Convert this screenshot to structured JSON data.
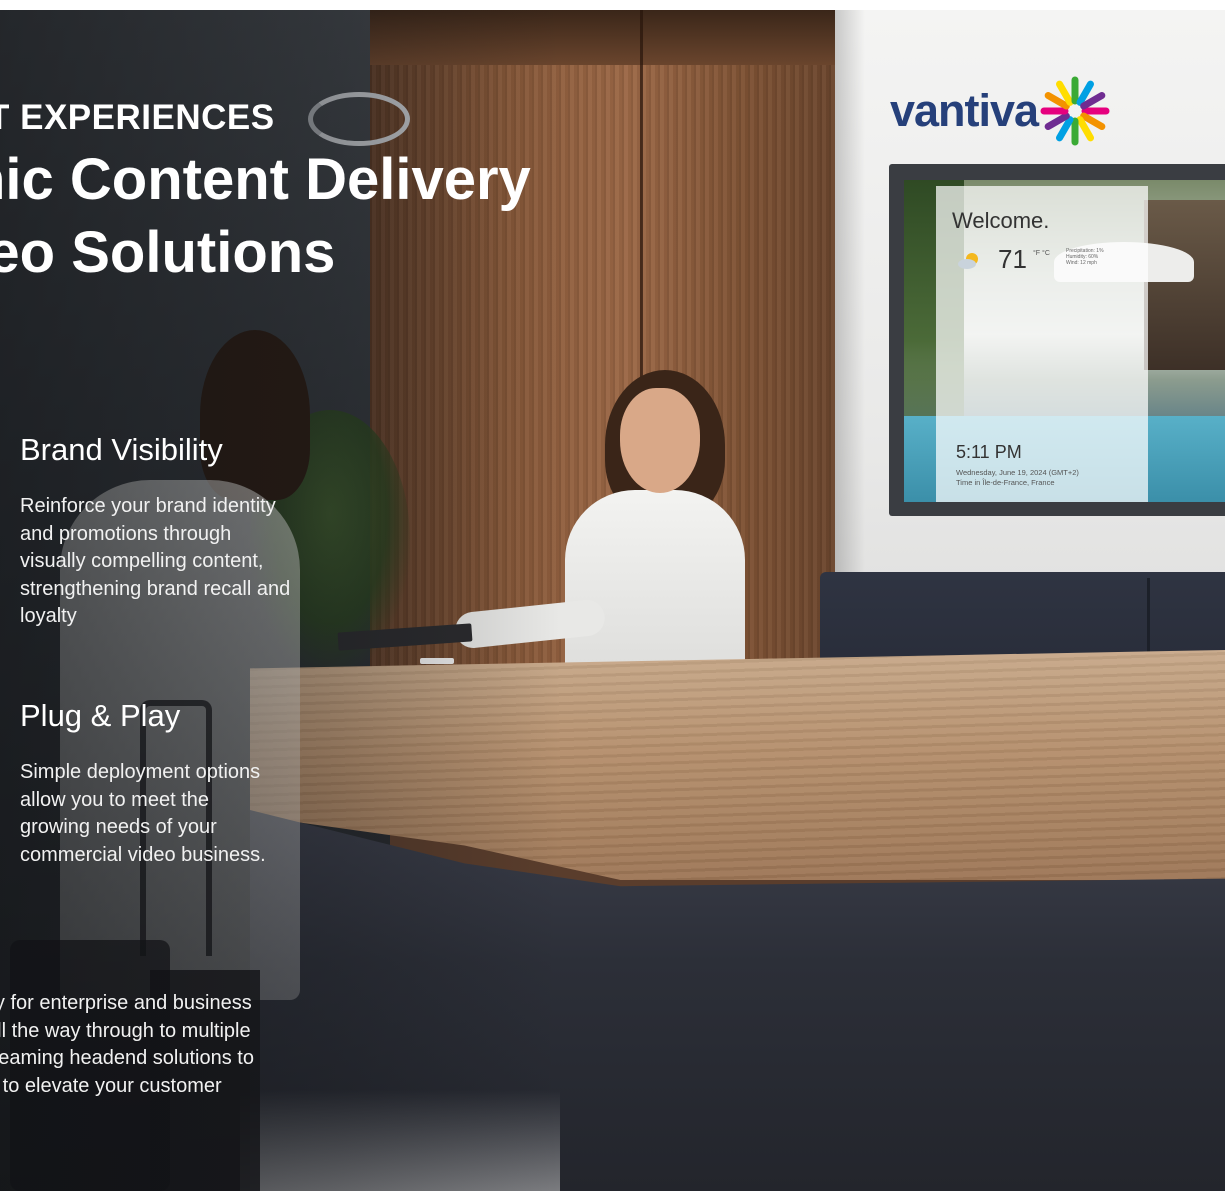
{
  "hero": {
    "eyebrow": "T EXPERIENCES",
    "headline_lines": [
      "nic Content Delivery",
      "deo Solutions"
    ]
  },
  "logo": {
    "wordmark": "vantiva",
    "brand_color": "#26407a",
    "mark_colors": [
      "#e6007e",
      "#f39200",
      "#ffdd00",
      "#3aaa35",
      "#00a0e3",
      "#6f2c91"
    ]
  },
  "signage_screen": {
    "greeting": "Welcome.",
    "temperature": "71",
    "temperature_units": "°F °C",
    "weather_details": [
      "Precipitation: 1%",
      "Humidity: 60%",
      "Wind: 12 mph"
    ],
    "time": "5:11 PM",
    "date_line": "Wednesday, June 19, 2024 (GMT+2)",
    "location_line": "Time in Île-de-France, France"
  },
  "features": [
    {
      "title": "Brand Visibility",
      "body_lines": [
        "Reinforce your brand identity",
        "and promotions through",
        "visually compelling content,",
        "strengthening brand recall and",
        "loyalty"
      ]
    },
    {
      "title": "Plug & Play",
      "body_lines": [
        "Simple deployment options",
        "allow you to meet the",
        "growing needs of your",
        "commercial video business."
      ]
    }
  ],
  "bottom_paragraph": {
    "lines": [
      "lly for enterprise and business",
      "all the way through to multiple",
      "treaming headend solutions to",
      "d to elevate your customer",
      "."
    ]
  }
}
